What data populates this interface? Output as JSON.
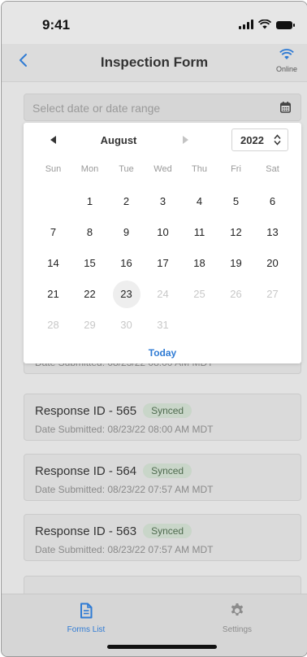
{
  "status": {
    "time": "9:41"
  },
  "header": {
    "title": "Inspection Form",
    "online_label": "Online"
  },
  "date_field": {
    "placeholder": "Select date or date range"
  },
  "calendar": {
    "month": "August",
    "year": "2022",
    "weekdays": [
      "Sun",
      "Mon",
      "Tue",
      "Wed",
      "Thu",
      "Fri",
      "Sat"
    ],
    "weeks": [
      [
        "",
        "1",
        "2",
        "3",
        "4",
        "5",
        "6"
      ],
      [
        "7",
        "8",
        "9",
        "10",
        "11",
        "12",
        "13"
      ],
      [
        "14",
        "15",
        "16",
        "17",
        "18",
        "19",
        "20"
      ],
      [
        "21",
        "22",
        "23",
        "24",
        "25",
        "26",
        "27"
      ],
      [
        "28",
        "29",
        "30",
        "31",
        "",
        "",
        ""
      ]
    ],
    "selected_day": "23",
    "today_label": "Today"
  },
  "responses": [
    {
      "title": "",
      "status": "",
      "date": "Date Submitted: 08/23/22 08:00 AM MDT"
    },
    {
      "title": "Response ID - 565",
      "status": "Synced",
      "date": "Date Submitted: 08/23/22 08:00 AM MDT"
    },
    {
      "title": "Response ID - 564",
      "status": "Synced",
      "date": "Date Submitted: 08/23/22 07:57 AM MDT"
    },
    {
      "title": "Response ID - 563",
      "status": "Synced",
      "date": "Date Submitted: 08/23/22 07:57 AM MDT"
    }
  ],
  "tabbar": {
    "forms_label": "Forms List",
    "settings_label": "Settings"
  },
  "colors": {
    "accent": "#2f7bd4",
    "synced_badge_bg": "#c9d6c9",
    "synced_badge_text": "#4f6b4f"
  }
}
